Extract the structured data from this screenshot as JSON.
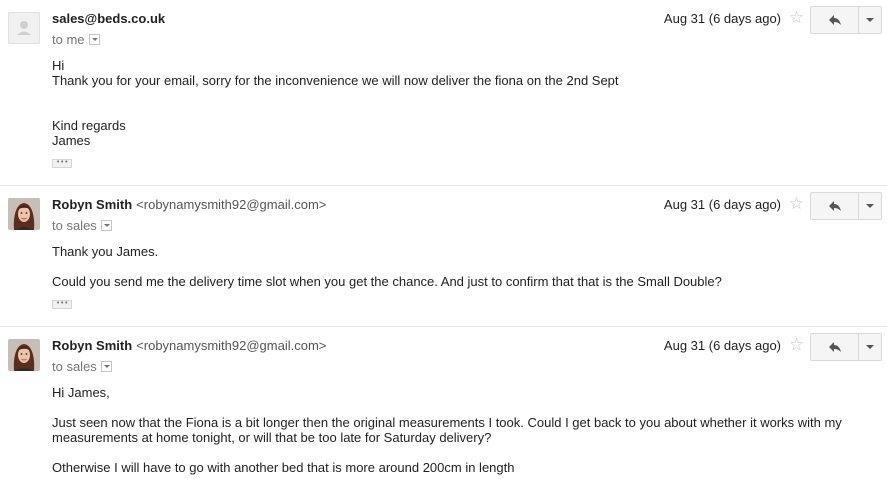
{
  "messages": [
    {
      "sender_name": "sales@beds.co.uk",
      "sender_email": "",
      "to": "to me",
      "date": "Aug 31 (6 days ago)",
      "body": {
        "line1": "Hi",
        "line2": "Thank you for your email, sorry for the inconvenience we will now deliver the fiona on the 2nd Sept",
        "line3": "Kind regards",
        "line4": "James"
      },
      "avatar": "generic-person-icon"
    },
    {
      "sender_name": "Robyn Smith",
      "sender_email": "<robynamysmith92@gmail.com>",
      "to": "to sales",
      "date": "Aug 31 (6 days ago)",
      "body": {
        "line1": "Thank you James.",
        "line2": "Could you send me the delivery time slot when you get the chance. And just to confirm that that is the Small Double?"
      },
      "avatar": "profile-photo"
    },
    {
      "sender_name": "Robyn Smith",
      "sender_email": "<robynamysmith92@gmail.com>",
      "to": "to sales",
      "date": "Aug 31 (6 days ago)",
      "body": {
        "line1": "Hi James,",
        "line2": "Just seen now that the Fiona is a bit longer then the original measurements I took. Could I get back to you about whether it works with my",
        "line3": "measurements at home tonight, or will that be too late for Saturday delivery?",
        "line4": "Otherwise I will have to go with another bed that is more around 200cm in length"
      },
      "avatar": "profile-photo"
    }
  ],
  "icons": {
    "star": "star-icon",
    "reply": "reply-icon",
    "more": "chevron-down-icon"
  },
  "colors": {
    "divider": "#e5e5e5",
    "button_bg": "#f5f5f5",
    "muted_text": "#777777"
  }
}
